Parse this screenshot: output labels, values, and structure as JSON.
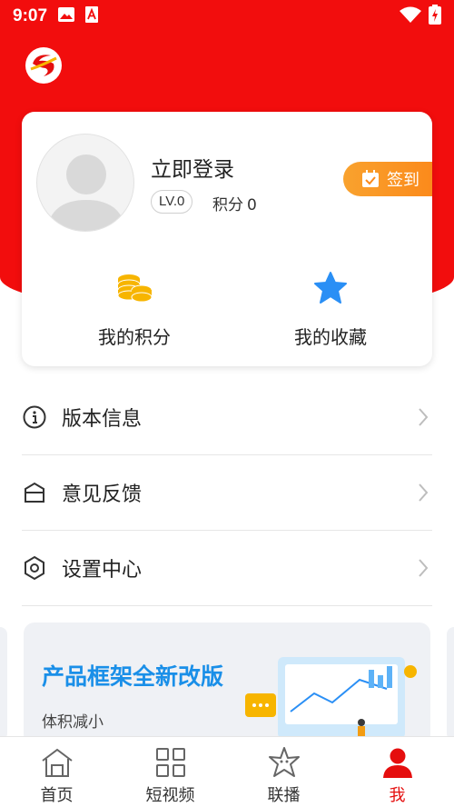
{
  "status_bar": {
    "time": "9:07"
  },
  "app_logo": {
    "icon": "app-logo-icon"
  },
  "profile": {
    "login_label": "立即登录",
    "level": "LV.0",
    "points_label": "积分",
    "points_value": "0",
    "checkin_label": "签到"
  },
  "quick_actions": [
    {
      "label": "我的积分",
      "icon": "coins-icon"
    },
    {
      "label": "我的收藏",
      "icon": "star-icon"
    }
  ],
  "menu": [
    {
      "label": "版本信息",
      "icon": "info-icon"
    },
    {
      "label": "意见反馈",
      "icon": "feedback-icon"
    },
    {
      "label": "设置中心",
      "icon": "settings-icon"
    }
  ],
  "banner": {
    "title": "产品框架全新改版",
    "subtitle": "体积减小"
  },
  "tabs": [
    {
      "label": "首页",
      "icon": "home-icon",
      "active": false
    },
    {
      "label": "短视频",
      "icon": "grid-icon",
      "active": false
    },
    {
      "label": "联播",
      "icon": "starfish-icon",
      "active": false
    },
    {
      "label": "我",
      "icon": "person-icon",
      "active": true
    }
  ],
  "colors": {
    "brand_red": "#f20d0d",
    "checkin_orange": "#fb8a1b",
    "banner_blue": "#1a8fe8",
    "star_blue": "#2a8ff5",
    "coin_gold": "#f7b500"
  }
}
